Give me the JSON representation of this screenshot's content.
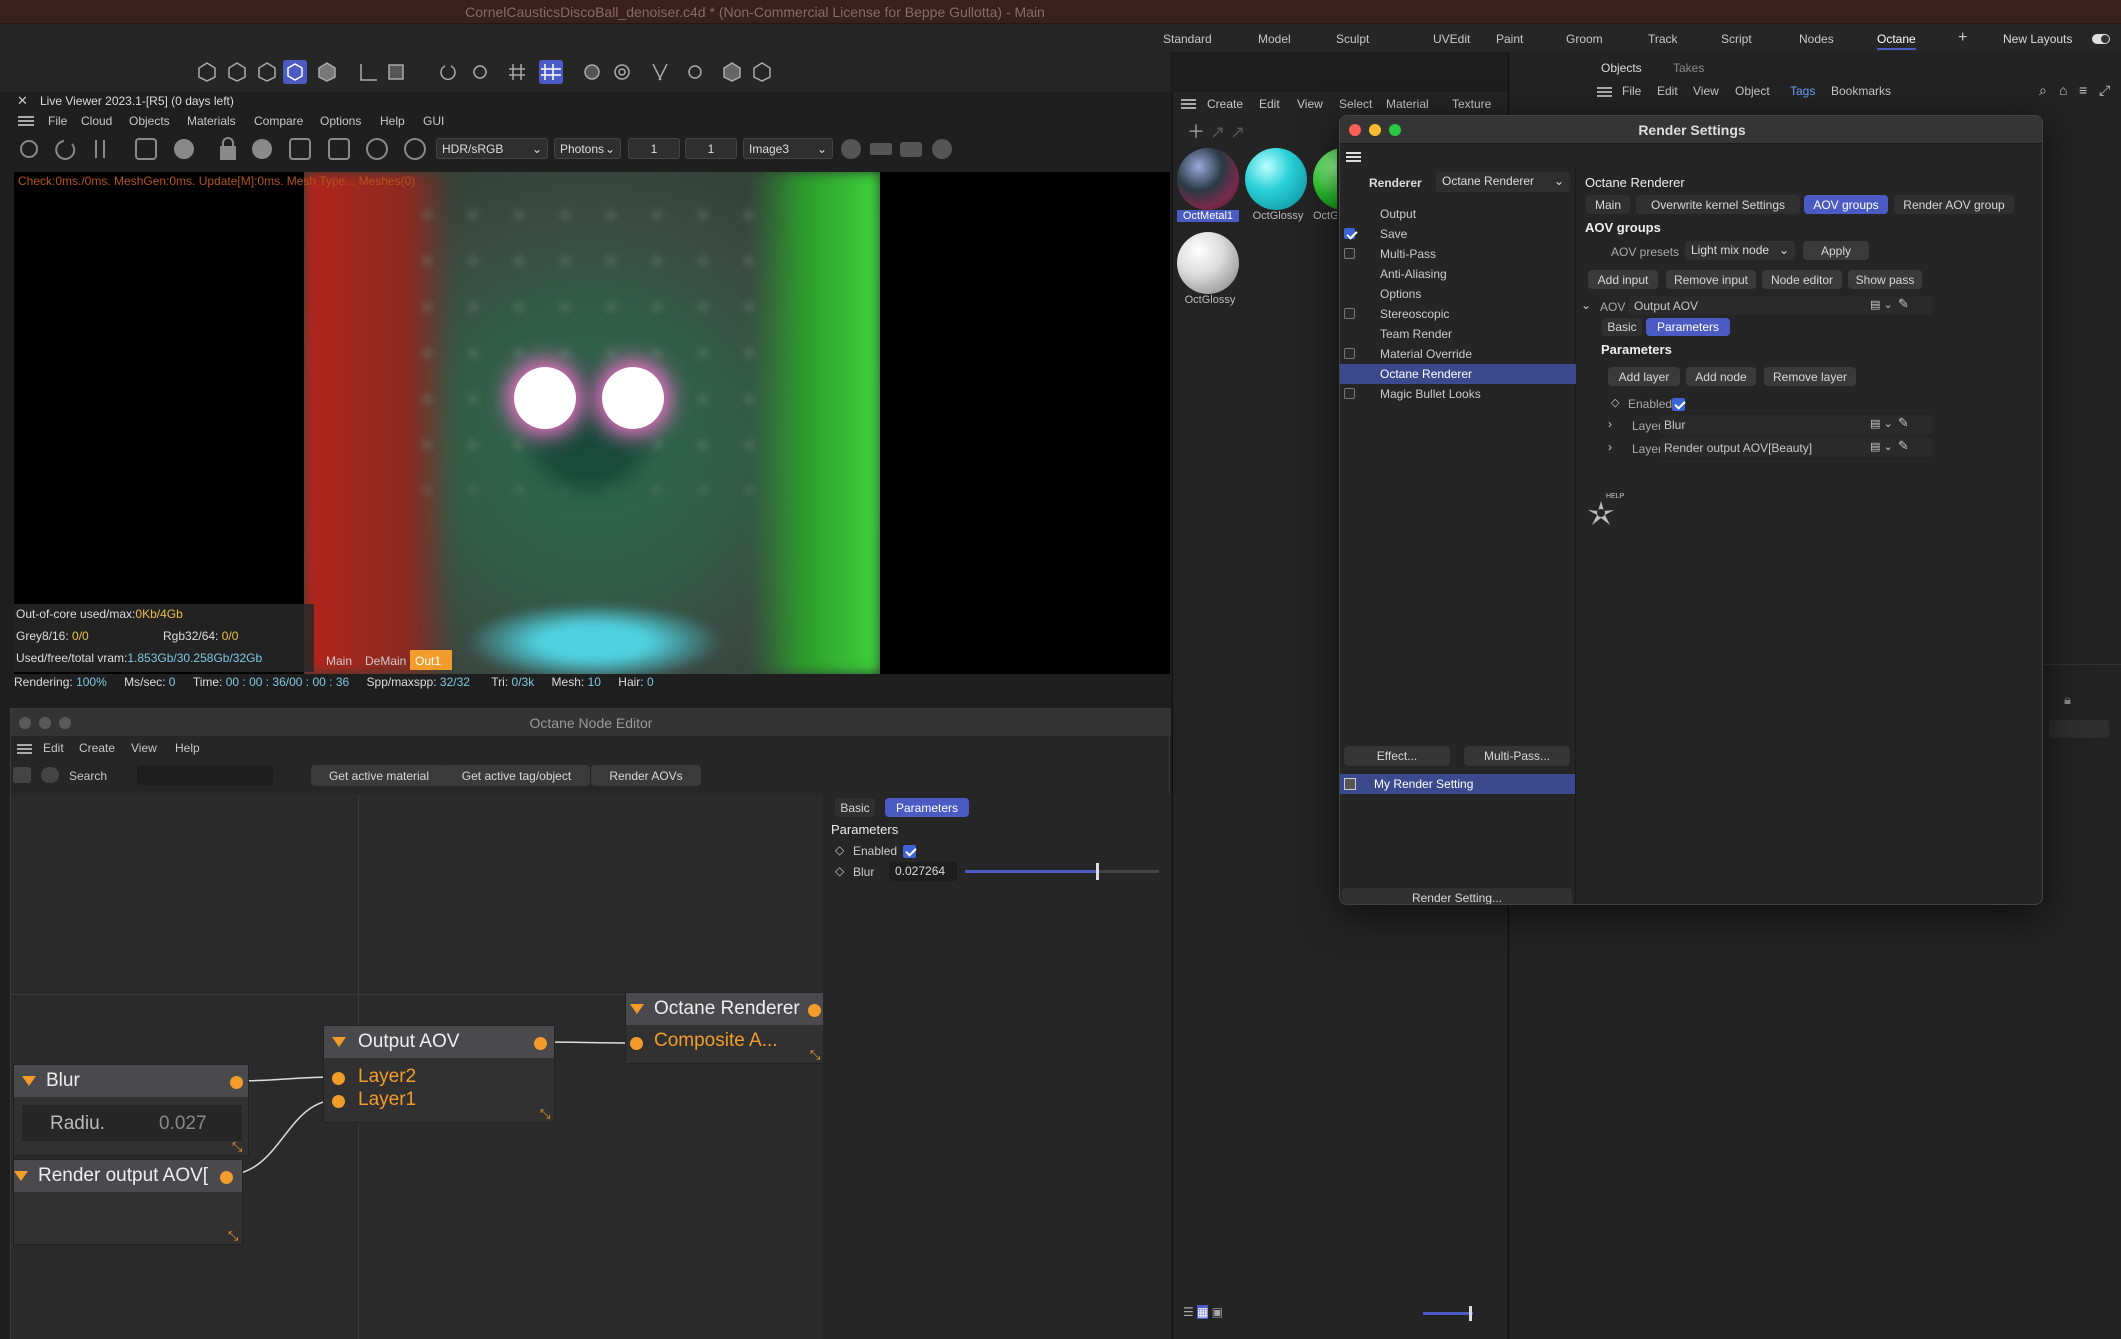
{
  "window": {
    "title": "CornelCausticsDiscoBall_denoiser.c4d * (Non-Commercial License for Beppe Gullotta) - Main"
  },
  "layouts": {
    "tabs": [
      "Standard",
      "Model",
      "Sculpt",
      "UVEdit",
      "Paint",
      "Groom",
      "Track",
      "Script",
      "Nodes",
      "Octane"
    ],
    "active": "Octane",
    "plus": "+",
    "new_layouts": "New Layouts"
  },
  "live_viewer": {
    "title": "Live Viewer 2023.1-[R5] (0 days left)",
    "menu": [
      "File",
      "Cloud",
      "Objects",
      "Materials",
      "Compare",
      "Options",
      "Help",
      "GUI"
    ],
    "colorspace": "HDR/sRGB",
    "mode": "Photons",
    "field1": "1",
    "field2": "1",
    "imager": "Image3",
    "check_line": "Check:0ms./0ms. MeshGen:0ms. Update[M]:0ms. Mesh Type... Meshes(0)",
    "stats": {
      "ooc_label": "Out-of-core used/max:",
      "ooc_value": "0Kb/4Gb",
      "grey_label": "Grey8/16:",
      "grey_value": "0/0",
      "rgb_label": "Rgb32/64:",
      "rgb_value": "0/0",
      "vram_label": "Used/free/total vram:",
      "vram_value": "1.853Gb/30.258Gb/32Gb"
    },
    "bottom_tabs": [
      "Main",
      "DeMain",
      "Out1"
    ],
    "status": {
      "rendering_label": "Rendering:",
      "rendering_value": "100%",
      "ms_label": "Ms/sec:",
      "ms_value": "0",
      "time_label": "Time:",
      "time_value": "00 : 00 : 36/00 : 00 : 36",
      "spp_label": "Spp/maxspp:",
      "spp_value": "32/32",
      "tri_label": "Tri:",
      "tri_value": "0/3k",
      "mesh_label": "Mesh:",
      "mesh_value": "10",
      "hair_label": "Hair:",
      "hair_value": "0"
    }
  },
  "material_manager": {
    "menu": [
      "Create",
      "Edit",
      "View",
      "Select",
      "Material",
      "Texture"
    ],
    "materials": [
      "OctMetal1",
      "OctGlossy",
      "OctG",
      "OctGlossy"
    ]
  },
  "objects_panel": {
    "tabs": [
      "Objects",
      "Takes"
    ],
    "menu": [
      "File",
      "Edit",
      "View",
      "Object",
      "Tags",
      "Bookmarks"
    ]
  },
  "render_settings": {
    "title": "Render Settings",
    "renderer_label": "Renderer",
    "renderer_value": "Octane Renderer",
    "list": [
      {
        "label": "Output",
        "check": "none"
      },
      {
        "label": "Save",
        "check": "on"
      },
      {
        "label": "Multi-Pass",
        "check": "off"
      },
      {
        "label": "Anti-Aliasing",
        "check": "none"
      },
      {
        "label": "Options",
        "check": "none"
      },
      {
        "label": "Stereoscopic",
        "check": "off"
      },
      {
        "label": "Team Render",
        "check": "none"
      },
      {
        "label": "Material Override",
        "check": "off"
      },
      {
        "label": "Octane Renderer",
        "check": "none",
        "selected": true
      },
      {
        "label": "Magic Bullet Looks",
        "check": "off"
      }
    ],
    "effect_btn": "Effect...",
    "multipass_btn": "Multi-Pass...",
    "setting_name": "My Render Setting",
    "render_setting_btn": "Render Setting...",
    "panel_title": "Octane Renderer",
    "tabs": [
      "Main",
      "Overwrite kernel Settings",
      "AOV groups",
      "Render AOV group"
    ],
    "active_tab": "AOV groups",
    "section": "AOV groups",
    "aov_presets_label": "AOV presets",
    "aov_presets_value": "Light mix node",
    "apply_btn": "Apply",
    "actions": [
      "Add input",
      "Remove input",
      "Node editor",
      "Show pass"
    ],
    "aov1_label": "AOV 1",
    "aov1_value": "Output AOV",
    "sub_tabs": [
      "Basic",
      "Parameters"
    ],
    "params_title": "Parameters",
    "layer_actions": [
      "Add layer",
      "Add node",
      "Remove layer"
    ],
    "enabled_label": "Enabled",
    "layer2_label": "Layer2",
    "layer2_value": "Blur",
    "layer1_label": "Layer1",
    "layer1_value": "Render output AOV[Beauty]",
    "help_text": "HELP"
  },
  "node_editor": {
    "title": "Octane Node Editor",
    "menu": [
      "Edit",
      "Create",
      "View",
      "Help"
    ],
    "search_label": "Search",
    "buttons": [
      "Get active material",
      "Get active tag/object",
      "Render AOVs"
    ],
    "tabs": [
      "Basic",
      "Parameters"
    ],
    "params_title": "Parameters",
    "enabled_label": "Enabled",
    "blur_label": "Blur",
    "blur_value": "0.027264",
    "blur_fraction": 0.68,
    "nodes": {
      "blur": {
        "title": "Blur",
        "param": "Radiu.",
        "param_value": "0.027"
      },
      "render_output": {
        "title": "Render output AOV["
      },
      "output_aov": {
        "title": "Output AOV",
        "in1": "Layer2",
        "in2": "Layer1"
      },
      "octane_renderer": {
        "title": "Octane Renderer",
        "in1": "Composite A..."
      }
    }
  },
  "colors": {
    "accent": "#4b5bc4",
    "node_port": "#f29c2b",
    "link_cyan": "#4fd0e0"
  }
}
